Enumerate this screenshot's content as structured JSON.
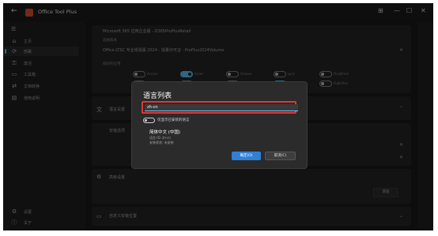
{
  "titlebar": {
    "back_glyph": "←",
    "app_title": "Office Tool Plus",
    "controls": [
      "⊞",
      "—",
      "☐",
      "✕"
    ]
  },
  "sidebar": {
    "items": [
      {
        "icon": "home-icon",
        "glyph": "⌂",
        "label": "主页"
      },
      {
        "icon": "deploy-icon",
        "glyph": "⟳",
        "label": "部署",
        "active": true
      },
      {
        "icon": "activate-icon",
        "glyph": "⚿",
        "label": "激活"
      },
      {
        "icon": "toolbox-icon",
        "glyph": "▭",
        "label": "工具箱"
      },
      {
        "icon": "convert-icon",
        "glyph": "⇄",
        "label": "文档转换"
      },
      {
        "icon": "documents-icon",
        "glyph": "▤",
        "label": "使用说明"
      },
      {
        "icon": "settings-icon",
        "glyph": "⚙",
        "label": "设置"
      },
      {
        "icon": "about-icon",
        "glyph": "ⓘ",
        "label": "关于"
      }
    ]
  },
  "background": {
    "product_line": "Microsoft 365 应用企业版 - O365ProPlusRetail",
    "section_label": "选择版本",
    "product_line_2": "Office LTSC 专业增强版 2024 - 批量许可证 - ProPlus2024Volume",
    "apps_label": "排除的应用",
    "apps": [
      "Access",
      "Excel",
      "Groove",
      "Lync",
      "OneDrive",
      "OneNote",
      "Outlook (Classic)",
      "Outlook (New)",
      "PowerPoint",
      "Publisher",
      "Teams",
      "Word"
    ],
    "row_labels": [
      "语言设置",
      "安装选项",
      "高级设置"
    ],
    "bottom_card_title": "自定义安装位置",
    "action_label": "浏览"
  },
  "dialog": {
    "title": "语言列表",
    "search_value": "zh-cn",
    "toggle_label": "仅显示已安装的语言",
    "language_name": "简体中文 (中国)",
    "language_code": "语言 ID: zh-cn",
    "language_status": "安装状态: 未安装",
    "confirm_label": "确定(O)",
    "cancel_label": "取消(C)"
  },
  "colors": {
    "accent": "#60cdff",
    "highlight_box": "#e23636",
    "primary_button": "#2f80d6",
    "logo": "#e4572e"
  }
}
